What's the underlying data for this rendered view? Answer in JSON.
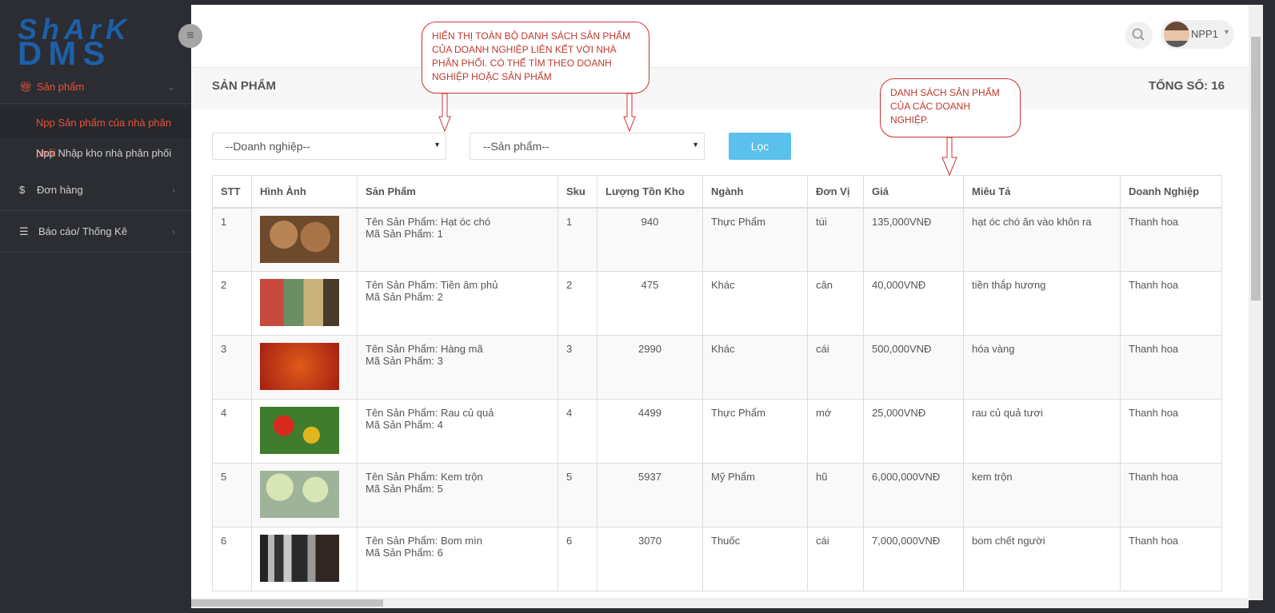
{
  "brand": {
    "line1": "ShArK",
    "line2": "DMS"
  },
  "sidebar": {
    "items": [
      {
        "label": "Sản phẩm",
        "icon": "gift-icon"
      },
      {
        "label": "Đơn hàng",
        "icon": "dollar-icon"
      },
      {
        "label": "Báo cáo/ Thống Kê",
        "icon": "report-icon"
      }
    ],
    "subitems": [
      {
        "label": "Npp Sản phẩm của nhà phân phối"
      },
      {
        "label": "Npp Nhập kho nhà phân phối"
      }
    ]
  },
  "header": {
    "user_name": "NPP1"
  },
  "page": {
    "title": "SẢN PHẨM",
    "total": "TỔNG SỐ: 16"
  },
  "filters": {
    "company_placeholder": "--Doanh nghiệp--",
    "product_placeholder": "--Sản phẩm--",
    "filter_label": "Lọc"
  },
  "table": {
    "headers": [
      "STT",
      "Hình Ảnh",
      "Sản Phẩm",
      "Sku",
      "Lượng Tồn Kho",
      "Ngành",
      "Đơn Vị",
      "Giá",
      "Miêu Tả",
      "Doanh Nghiệp"
    ],
    "rows": [
      {
        "stt": "1",
        "name": "Tên Sản Phẩm: Hạt óc chó",
        "code": "Mã Sản Phẩm: 1",
        "sku": "1",
        "stock": "940",
        "industry": "Thực Phẩm",
        "unit": "túi",
        "price": "135,000VNĐ",
        "desc": "hạt óc chó ăn vào khôn ra",
        "company": "Thanh hoa"
      },
      {
        "stt": "2",
        "name": "Tên Sản Phẩm: Tiền âm phủ",
        "code": "Mã Sản Phẩm: 2",
        "sku": "2",
        "stock": "475",
        "industry": "Khác",
        "unit": "cân",
        "price": "40,000VNĐ",
        "desc": "tiền thắp hương",
        "company": "Thanh hoa"
      },
      {
        "stt": "3",
        "name": "Tên Sản Phẩm: Hàng mã",
        "code": "Mã Sản Phẩm: 3",
        "sku": "3",
        "stock": "2990",
        "industry": "Khác",
        "unit": "cái",
        "price": "500,000VNĐ",
        "desc": "hóa vàng",
        "company": "Thanh hoa"
      },
      {
        "stt": "4",
        "name": "Tên Sản Phẩm: Rau củ quả",
        "code": "Mã Sản Phẩm: 4",
        "sku": "4",
        "stock": "4499",
        "industry": "Thực Phẩm",
        "unit": "mớ",
        "price": "25,000VNĐ",
        "desc": "rau củ quả tươi",
        "company": "Thanh hoa"
      },
      {
        "stt": "5",
        "name": "Tên Sản Phẩm: Kem trộn",
        "code": "Mã Sản Phẩm: 5",
        "sku": "5",
        "stock": "5937",
        "industry": "Mỹ Phẩm",
        "unit": "hũ",
        "price": "6,000,000VNĐ",
        "desc": "kem trộn",
        "company": "Thanh hoa"
      },
      {
        "stt": "6",
        "name": "Tên Sản Phẩm: Bom mìn",
        "code": "Mã Sản Phẩm: 6",
        "sku": "6",
        "stock": "3070",
        "industry": "Thuốc",
        "unit": "cái",
        "price": "7,000,000VNĐ",
        "desc": "bom chết người",
        "company": "Thanh hoa"
      }
    ]
  },
  "annotations": {
    "callout1": "HIỂN THỊ TOÀN BỘ DANH SÁCH SẢN PHẨM CỦA DOANH NGHIỆP LIÊN KẾT VỚI NHÀ PHÂN PHỐI. CÓ THỂ TÌM THEO DOANH NGHIỆP HOẶC SẢN PHẨM",
    "callout2": "DANH SÁCH SẢN PHẨM CỦA CÁC DOANH NGHIỆP."
  },
  "colors": {
    "accent": "#e8533a",
    "filter_button": "#5bc0eb",
    "sidebar": "#2b2d33",
    "annotation": "#c0392b"
  }
}
